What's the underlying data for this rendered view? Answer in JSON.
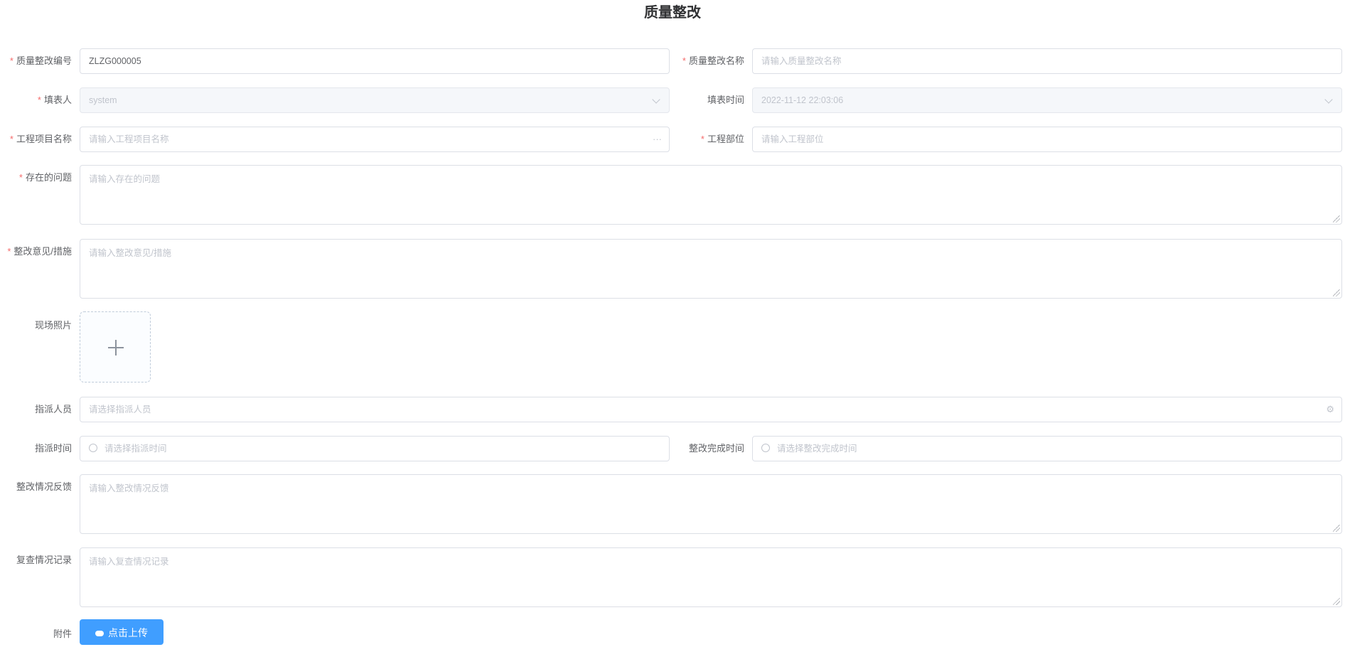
{
  "title": "质量整改",
  "required_mark": "*",
  "fields": {
    "code": {
      "label": "质量整改编号",
      "value": "ZLZG000005"
    },
    "name": {
      "label": "质量整改名称",
      "placeholder": "请输入质量整改名称"
    },
    "filler": {
      "label": "填表人",
      "value": "system"
    },
    "fill_time": {
      "label": "填表时间",
      "value": "2022-11-12 22:03:06"
    },
    "project": {
      "label": "工程项目名称",
      "placeholder": "请输入工程项目名称",
      "suffix": "···"
    },
    "part": {
      "label": "工程部位",
      "placeholder": "请输入工程部位"
    },
    "problem": {
      "label": "存在的问题",
      "placeholder": "请输入存在的问题"
    },
    "measures": {
      "label": "整改意见/措施",
      "placeholder": "请输入整改意见/措施"
    },
    "photos": {
      "label": "现场照片"
    },
    "assignee": {
      "label": "指派人员",
      "placeholder": "请选择指派人员"
    },
    "assign_time": {
      "label": "指派时间",
      "placeholder": "请选择指派时间"
    },
    "finish_time": {
      "label": "整改完成时间",
      "placeholder": "请选择整改完成时间"
    },
    "feedback": {
      "label": "整改情况反馈",
      "placeholder": "请输入整改情况反馈"
    },
    "review": {
      "label": "复查情况记录",
      "placeholder": "请输入复查情况记录"
    },
    "attachment": {
      "label": "附件",
      "button": "点击上传"
    }
  },
  "colors": {
    "accent": "#409eff",
    "required": "#f56c6c"
  }
}
